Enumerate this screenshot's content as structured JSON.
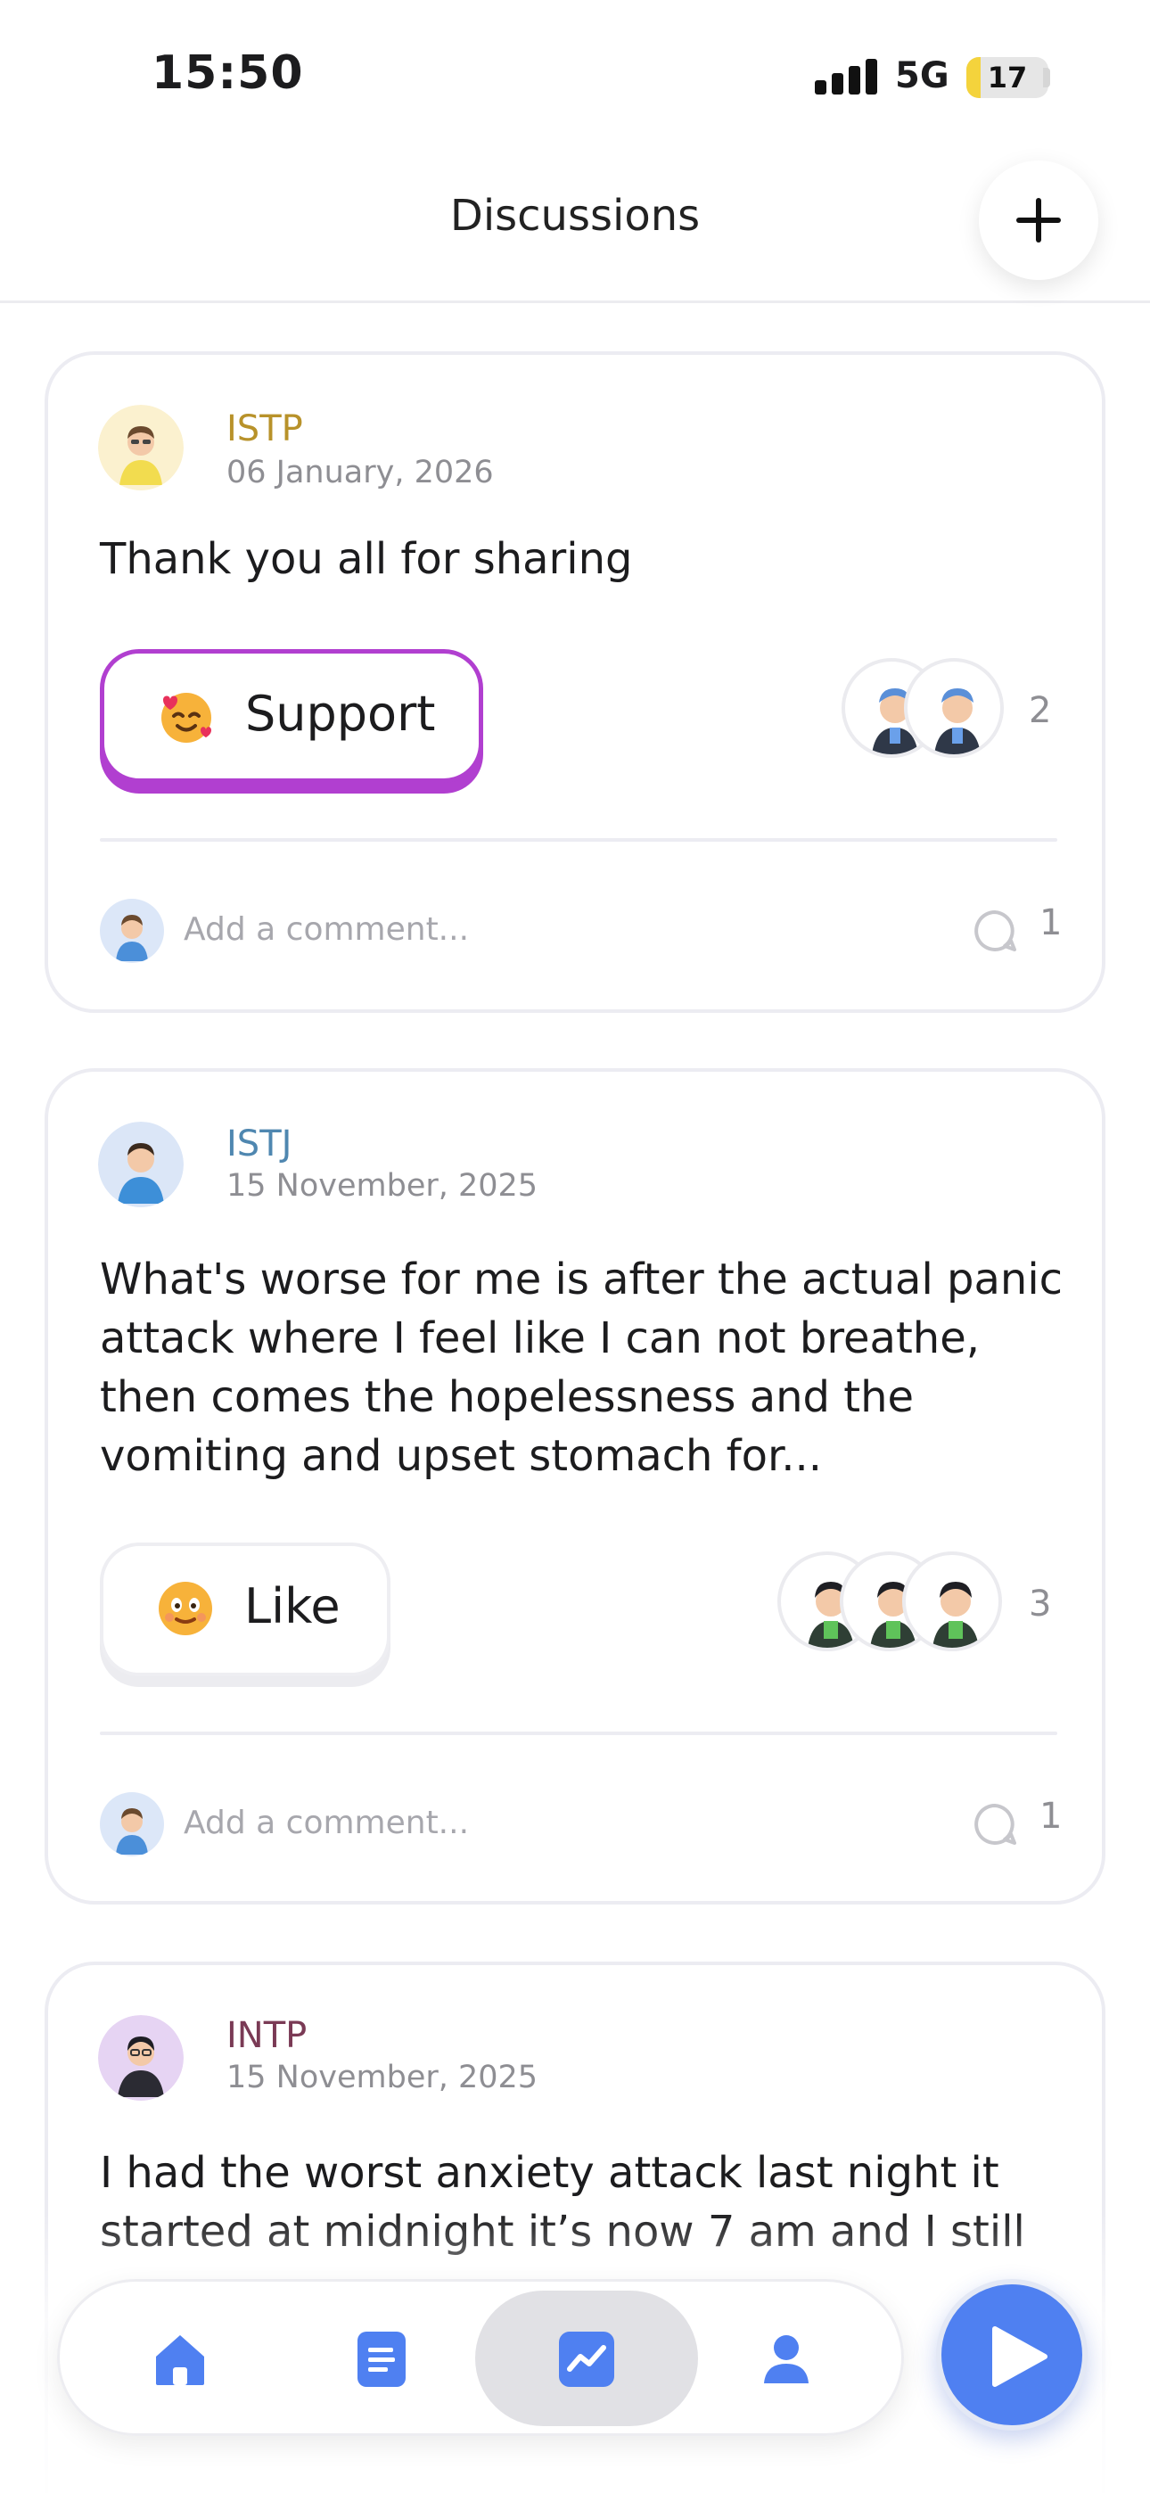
{
  "status_bar": {
    "time": "15:50",
    "network": "5G",
    "battery": "17",
    "battery_level_percent": 17
  },
  "header": {
    "title": "Discussions",
    "add_icon": "plus-icon"
  },
  "posts": [
    {
      "author_type": "ISTP",
      "author_color": "#b8922a",
      "date": "06 January, 2026",
      "body": "Thank you all for sharing",
      "reaction": {
        "label": "Support",
        "emoji": "smiling-face-with-hearts",
        "selected": true
      },
      "reactors_count": "2",
      "comment_placeholder": "Add a comment...",
      "comment_count": "1"
    },
    {
      "author_type": "ISTJ",
      "author_color": "#4f87b0",
      "date": "15 November, 2025",
      "body": "What's worse for me is after the actual panic attack where I feel like I can not breathe, then comes the hopelessness and the vomiting and upset stomach for...",
      "reaction": {
        "label": "Like",
        "emoji": "grinning-face",
        "selected": false
      },
      "reactors_count": "3",
      "comment_placeholder": "Add a comment...",
      "comment_count": "1"
    },
    {
      "author_type": "INTP",
      "author_color": "#7a3a55",
      "date": "15 November, 2025",
      "body": "I had the worst anxiety attack last night it started at midnight it’s now 7 am and I still"
    }
  ],
  "bottom_nav": {
    "tabs": [
      {
        "icon": "home-icon"
      },
      {
        "icon": "journal-icon"
      },
      {
        "icon": "insights-icon",
        "active": true
      },
      {
        "icon": "profile-icon"
      }
    ],
    "play_icon": "play-icon"
  },
  "colors": {
    "accent_blue": "#4f80f1",
    "support_purple": "#b13fd0"
  }
}
